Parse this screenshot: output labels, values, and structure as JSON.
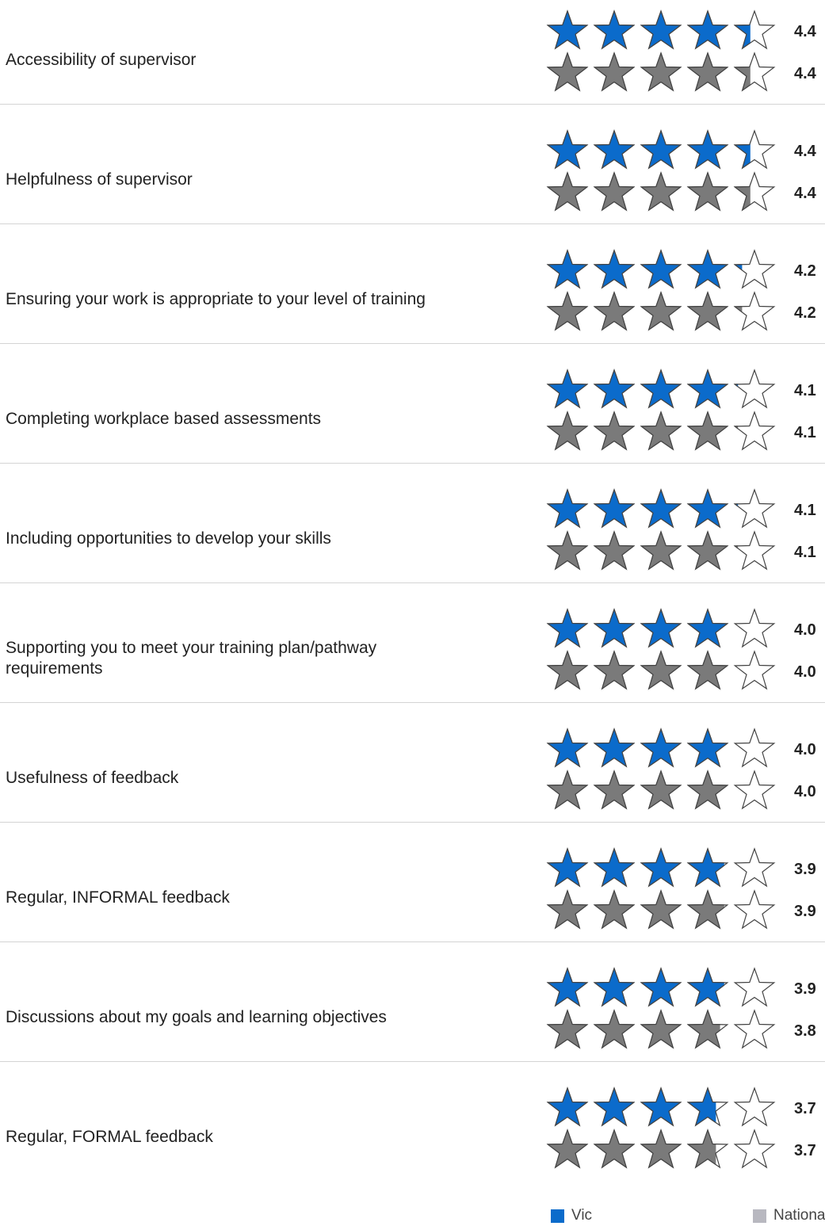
{
  "chart_data": {
    "type": "rating",
    "scale_max": 5,
    "colors": {
      "Vic": "#0b6bcb",
      "National": "#7a7a7a",
      "outline": "#444444"
    },
    "series": [
      {
        "name": "Vic",
        "color": "#0b6bcb"
      },
      {
        "name": "National",
        "color": "#b8b8c0"
      }
    ],
    "rows": [
      {
        "label": "Accessibility of supervisor",
        "vic": 4.4,
        "vic_label": "4.4",
        "national": 4.4,
        "national_label": "4.4"
      },
      {
        "label": "Helpfulness of supervisor",
        "vic": 4.4,
        "vic_label": "4.4",
        "national": 4.4,
        "national_label": "4.4"
      },
      {
        "label": "Ensuring your work is appropriate to your level of training",
        "vic": 4.2,
        "vic_label": "4.2",
        "national": 4.2,
        "national_label": "4.2"
      },
      {
        "label": "Completing workplace based assessments",
        "vic": 4.1,
        "vic_label": "4.1",
        "national": 4.1,
        "national_label": "4.1"
      },
      {
        "label": "Including opportunities to develop your skills",
        "vic": 4.1,
        "vic_label": "4.1",
        "national": 4.1,
        "national_label": "4.1"
      },
      {
        "label": "Supporting you to meet your training plan/pathway requirements",
        "vic": 4.0,
        "vic_label": "4.0",
        "national": 4.0,
        "national_label": "4.0"
      },
      {
        "label": "Usefulness of feedback",
        "vic": 4.0,
        "vic_label": "4.0",
        "national": 4.0,
        "national_label": "4.0"
      },
      {
        "label": "Regular, INFORMAL feedback",
        "vic": 3.9,
        "vic_label": "3.9",
        "national": 3.9,
        "national_label": "3.9"
      },
      {
        "label": "Discussions about my goals and learning objectives",
        "vic": 3.9,
        "vic_label": "3.9",
        "national": 3.8,
        "national_label": "3.8"
      },
      {
        "label": "Regular, FORMAL feedback",
        "vic": 3.7,
        "vic_label": "3.7",
        "national": 3.7,
        "national_label": "3.7"
      }
    ],
    "legend": [
      {
        "name": "Vic",
        "color": "#0b6bcb"
      },
      {
        "name": "National",
        "color": "#b8b8c0"
      }
    ]
  }
}
